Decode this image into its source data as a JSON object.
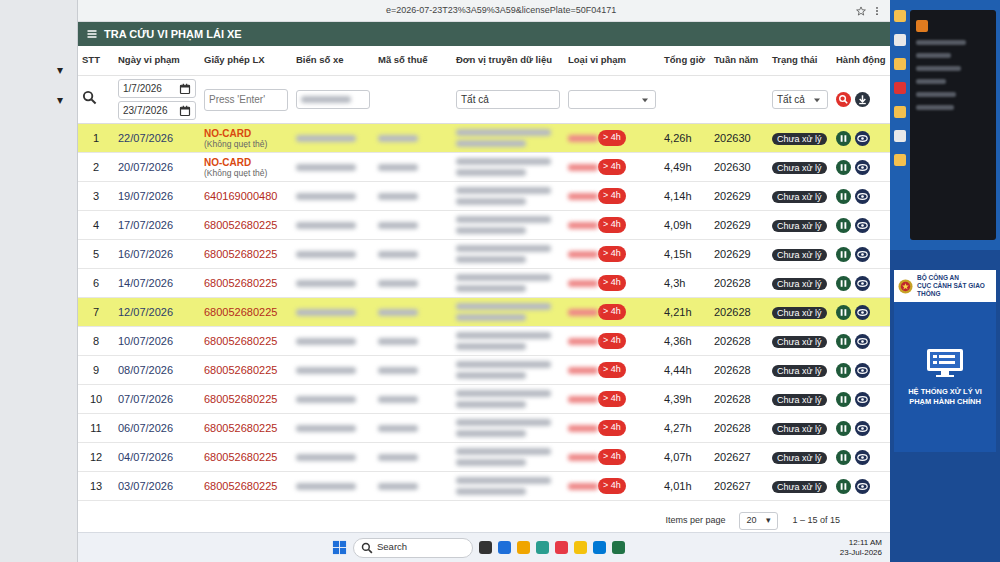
{
  "browser": {
    "url": "e=2026-07-23T23%3A59%3A59&licensePlate=50F04171"
  },
  "page": {
    "title": "TRA CỨU VI PHẠM LÁI XE"
  },
  "sidebar": {
    "items": [
      "▾",
      "▾"
    ]
  },
  "table": {
    "columns": [
      "STT",
      "Ngày vi phạm",
      "Giấy phép LX",
      "Biển số xe",
      "Mã số thuế",
      "Đơn vị truyền dữ liệu",
      "Loại vi phạm",
      "Tổng giờ",
      "Tuần năm",
      "Trạng thái",
      "Hành động"
    ],
    "filters": {
      "date_from": "1/7/2026",
      "date_to": "23/7/2026",
      "license_placeholder": "Press 'Enter'",
      "unit": "Tất cả",
      "status": "Tất cả"
    },
    "rows": [
      {
        "stt": "1",
        "date": "22/07/2026",
        "kind": "no-card",
        "license": "NO-CARD",
        "license_note": "(Không quẹt thẻ)",
        "violation": "> 4h",
        "hours": "4,26h",
        "week": "202630",
        "status": "Chưa xử lý",
        "highlighted": true
      },
      {
        "stt": "2",
        "date": "20/07/2026",
        "kind": "no-card",
        "license": "NO-CARD",
        "license_note": "(Không quẹt thẻ)",
        "violation": "> 4h",
        "hours": "4,49h",
        "week": "202630",
        "status": "Chưa xử lý",
        "highlighted": false
      },
      {
        "stt": "3",
        "date": "19/07/2026",
        "kind": "card",
        "license": "640169000480",
        "violation": "> 4h",
        "hours": "4,14h",
        "week": "202629",
        "status": "Chưa xử lý",
        "highlighted": false
      },
      {
        "stt": "4",
        "date": "17/07/2026",
        "kind": "card",
        "license": "680052680225",
        "violation": "> 4h",
        "hours": "4,09h",
        "week": "202629",
        "status": "Chưa xử lý",
        "highlighted": false
      },
      {
        "stt": "5",
        "date": "16/07/2026",
        "kind": "card",
        "license": "680052680225",
        "violation": "> 4h",
        "hours": "4,15h",
        "week": "202629",
        "status": "Chưa xử lý",
        "highlighted": false
      },
      {
        "stt": "6",
        "date": "14/07/2026",
        "kind": "card",
        "license": "680052680225",
        "violation": "> 4h",
        "hours": "4,3h",
        "week": "202628",
        "status": "Chưa xử lý",
        "highlighted": false
      },
      {
        "stt": "7",
        "date": "12/07/2026",
        "kind": "card",
        "license": "680052680225",
        "violation": "> 4h",
        "hours": "4,21h",
        "week": "202628",
        "status": "Chưa xử lý",
        "highlighted": true
      },
      {
        "stt": "8",
        "date": "10/07/2026",
        "kind": "card",
        "license": "680052680225",
        "violation": "> 4h",
        "hours": "4,36h",
        "week": "202628",
        "status": "Chưa xử lý",
        "highlighted": false
      },
      {
        "stt": "9",
        "date": "08/07/2026",
        "kind": "card",
        "license": "680052680225",
        "violation": "> 4h",
        "hours": "4,44h",
        "week": "202628",
        "status": "Chưa xử lý",
        "highlighted": false
      },
      {
        "stt": "10",
        "date": "07/07/2026",
        "kind": "card",
        "license": "680052680225",
        "violation": "> 4h",
        "hours": "4,39h",
        "week": "202628",
        "status": "Chưa xử lý",
        "highlighted": false
      },
      {
        "stt": "11",
        "date": "06/07/2026",
        "kind": "card",
        "license": "680052680225",
        "violation": "> 4h",
        "hours": "4,27h",
        "week": "202628",
        "status": "Chưa xử lý",
        "highlighted": false
      },
      {
        "stt": "12",
        "date": "04/07/2026",
        "kind": "card",
        "license": "680052680225",
        "violation": "> 4h",
        "hours": "4,07h",
        "week": "202627",
        "status": "Chưa xử lý",
        "highlighted": false
      },
      {
        "stt": "13",
        "date": "03/07/2026",
        "kind": "card",
        "license": "680052680225",
        "violation": "> 4h",
        "hours": "4,01h",
        "week": "202627",
        "status": "Chưa xử lý",
        "highlighted": false
      }
    ]
  },
  "pagination": {
    "label": "Items per page",
    "size": "20",
    "caret": "▾",
    "range": "1 – 15 of 15"
  },
  "taskbar": {
    "search": "Search",
    "time": "12:11 AM",
    "date": "23-Jul-2026"
  },
  "desktop": {
    "org": "BỘ CÔNG AN",
    "dept": "CỤC CẢNH SÁT GIAO THÔNG",
    "system": "HỆ THỐNG XỬ LÝ VI PHẠM HÀNH CHÍNH"
  }
}
